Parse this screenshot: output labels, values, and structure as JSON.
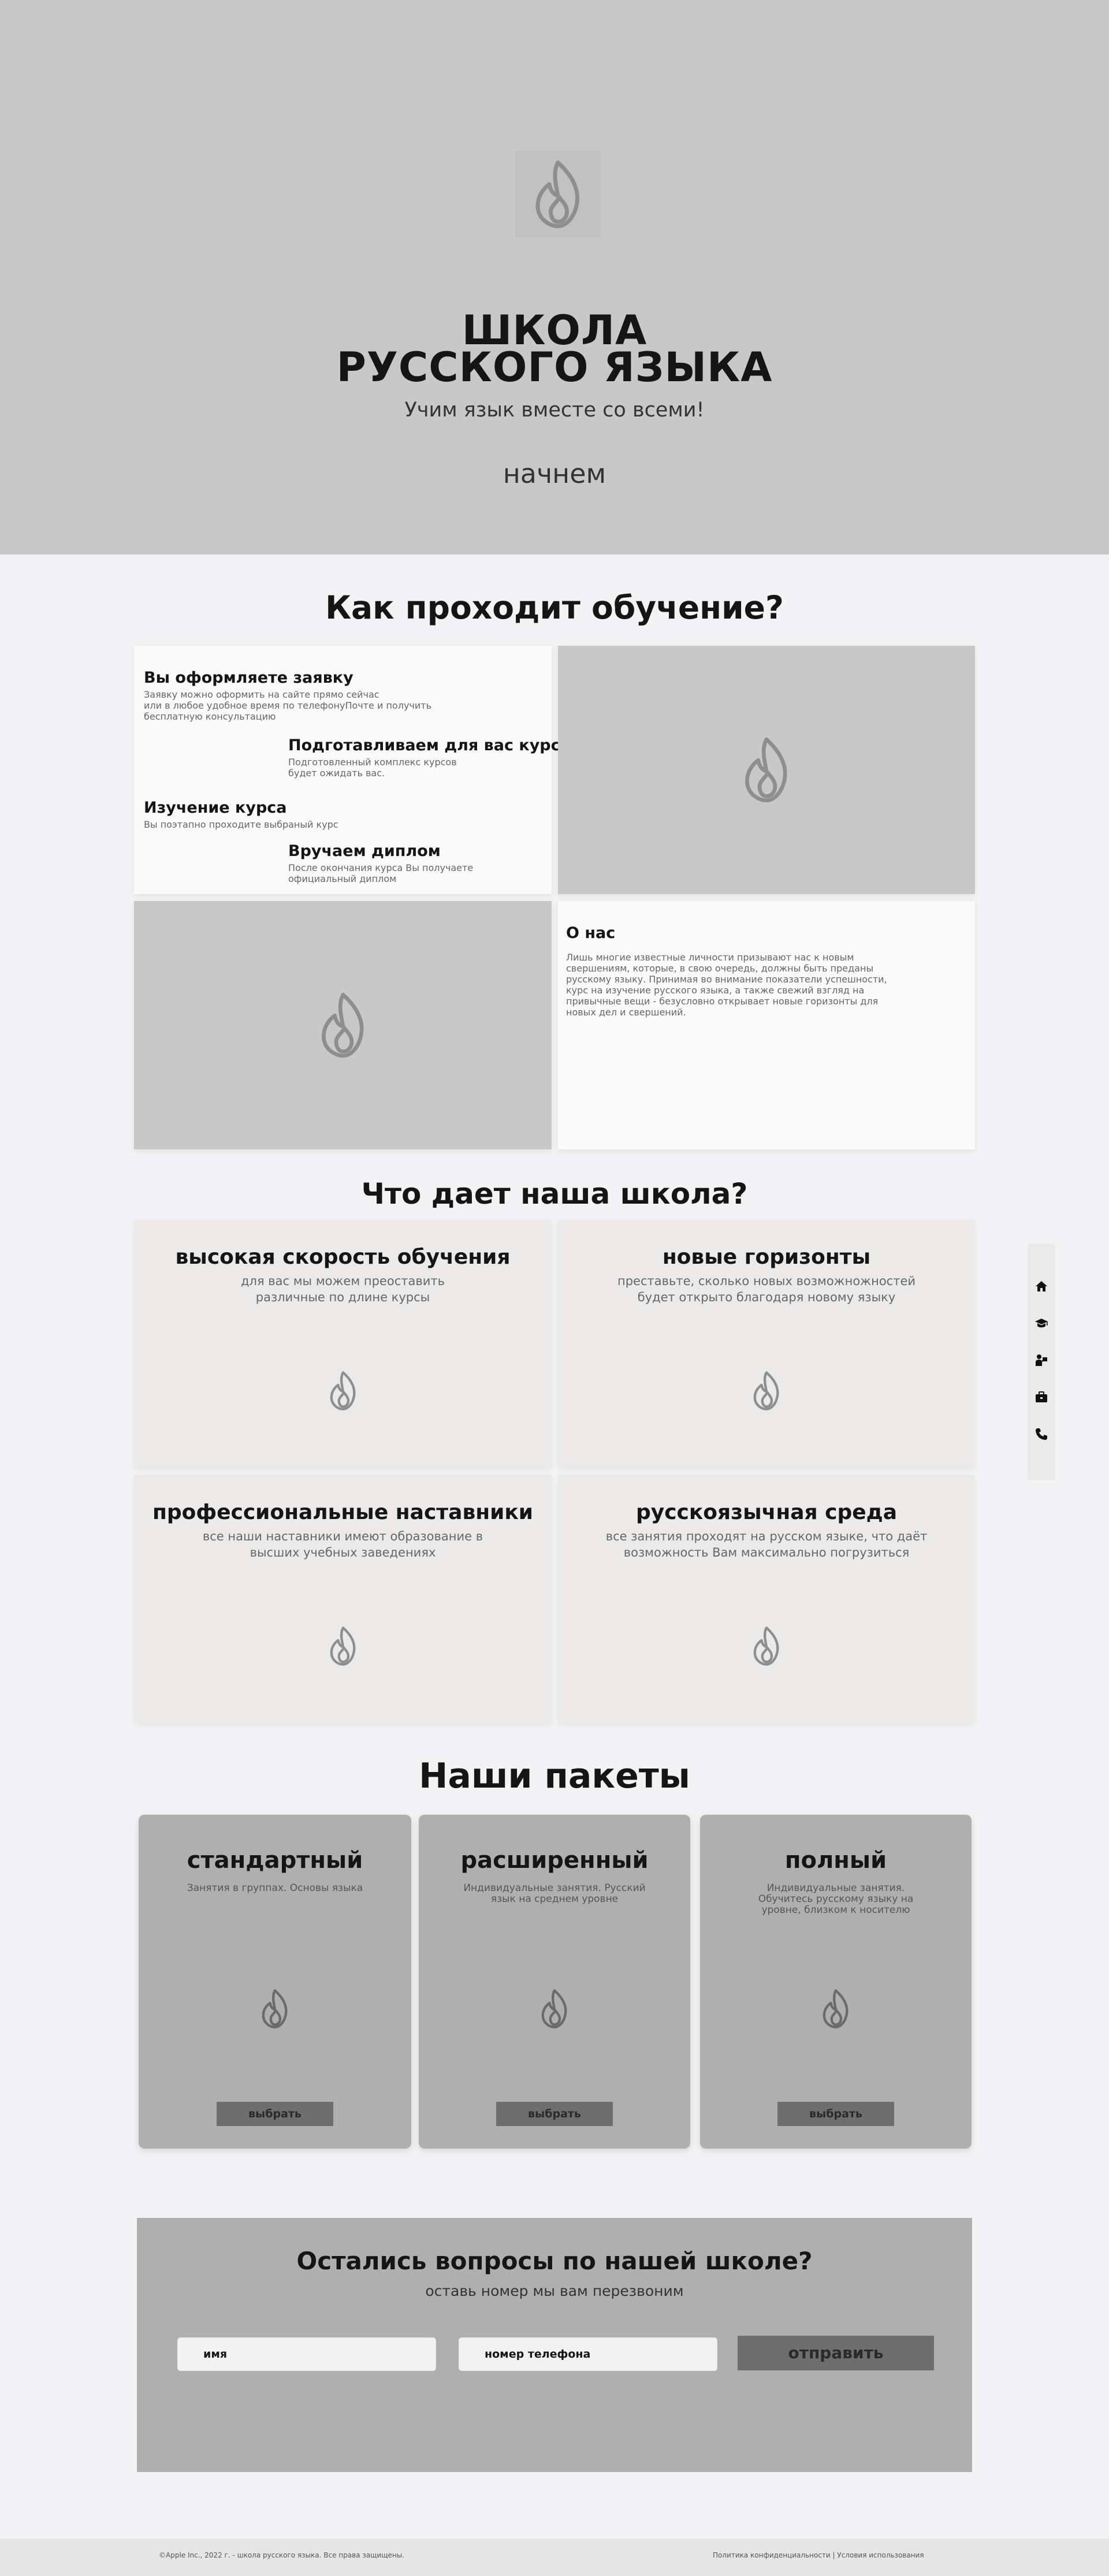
{
  "hero": {
    "logo_icon": "flame-icon",
    "title_line1": "ШКОЛА",
    "title_line2": "РУССКОГО ЯЗЫКА",
    "subtitle": "Учим язык вместе со всеми!",
    "cta_label": "начнем"
  },
  "process": {
    "title": "Как проходит обучение?",
    "steps": [
      {
        "title": "Вы оформляете заявку",
        "desc_line1": "Заявку можно оформить на сайте прямо сейчас",
        "desc_line2": "или в любое удобное время по телефонуПочте и получить",
        "desc_line3": "бесплатную консультацию"
      },
      {
        "title": "Подготавливаем  для вас курс",
        "desc_line1": "Подготовленный комплекс курсов",
        "desc_line2": "будет ожидать вас."
      },
      {
        "title": "Изучение курса",
        "desc_line1": "Вы поэтапно проходите выбраный курс"
      },
      {
        "title": "Вручаем диплом",
        "desc_line1": "После окончания курса Вы получаете",
        "desc_line2": "официальный диплом"
      }
    ],
    "image_icon": "flame-icon"
  },
  "about": {
    "title": "О нас",
    "text": "Лишь многие известные личности призывают нас к новым свершениям, которые, в свою очередь, должны быть преданы русскому языку. Принимая во внимание показатели успешности, курс на изучение русского языка, а также свежий взгляд на привычные вещи - безусловно открывает новые горизонты для новых дел и свершений."
  },
  "benefits": {
    "title": "Что дает наша школа?",
    "items": [
      {
        "title": "высокая скорость обучения",
        "desc_line1": "для вас мы можем преоставить",
        "desc_line2": "различные по длине курсы"
      },
      {
        "title": "новые горизонты",
        "desc_line1": "преставьте, сколько новых возможножностей",
        "desc_line2": "будет открыто благодаря новому языку"
      },
      {
        "title": "профессиональные наставники",
        "desc_line1": "все наши наставники имеют образование в",
        "desc_line2": "высших учебных заведениях"
      },
      {
        "title": "русскоязычная среда",
        "desc_line1": "все занятия проходят на русском языке, что даёт",
        "desc_line2": "возможность Вам максимально погрузиться"
      }
    ]
  },
  "side_nav": {
    "items": [
      "home-icon",
      "graduation-cap-icon",
      "teacher-icon",
      "briefcase-icon",
      "phone-icon"
    ]
  },
  "packages": {
    "title": "Наши пакеты",
    "items": [
      {
        "title": "стандартный",
        "desc": "Занятия в группах. Основы языка",
        "button": "выбрать"
      },
      {
        "title": "расширенный",
        "desc": "Индивидуальные занятия. Русский язык на среднем уровне",
        "button": "выбрать"
      },
      {
        "title": "полный",
        "desc": "Индивидуальные занятия. Обучитесь русскому языку на уровне, близком к носителю",
        "button": "выбрать"
      }
    ]
  },
  "contact": {
    "title": "Остались вопросы по нашей школе?",
    "subtitle": "оставь номер мы вам перезвоним",
    "name_placeholder": "имя",
    "phone_placeholder": "номер телефона",
    "submit_label": "отправить"
  },
  "footer": {
    "copyright": "©Apple Inc., 2022 г. - школа русского языка. Все права защищены.",
    "privacy_link": "Политика конфиденциальности",
    "separator": "|",
    "terms_link": "Условия использования"
  },
  "colors": {
    "hero_bg": "#c8c8c8",
    "page_bg": "#f3f3f5",
    "feature_bg": "#ebeae9",
    "package_bg": "#afafaf",
    "button_bg": "#6e6e6e",
    "icon_grey": "#8e8e8e"
  }
}
